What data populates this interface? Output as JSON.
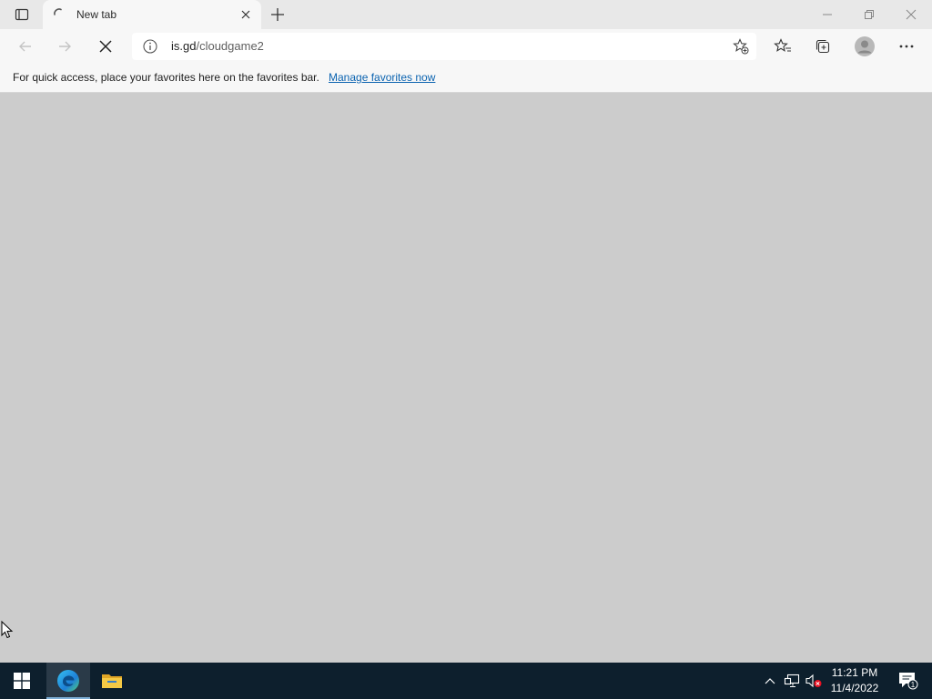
{
  "browser": {
    "tab": {
      "title": "New tab"
    },
    "address_bar": {
      "url_host": "is.gd",
      "url_path": "/cloudgame2"
    },
    "favorites_bar": {
      "message": "For quick access, place your favorites here on the favorites bar.",
      "link": "Manage favorites now"
    }
  },
  "taskbar": {
    "apps": [
      "windows-start",
      "microsoft-edge",
      "file-explorer"
    ],
    "clock": {
      "time": "11:21 PM",
      "date": "11/4/2022"
    },
    "notification_count": "1"
  },
  "colors": {
    "titlebar": "#e8e8e8",
    "toolbar": "#f7f7f7",
    "content": "#cccccc",
    "taskbar": "#0d1f2d",
    "link": "#0b63b0"
  }
}
